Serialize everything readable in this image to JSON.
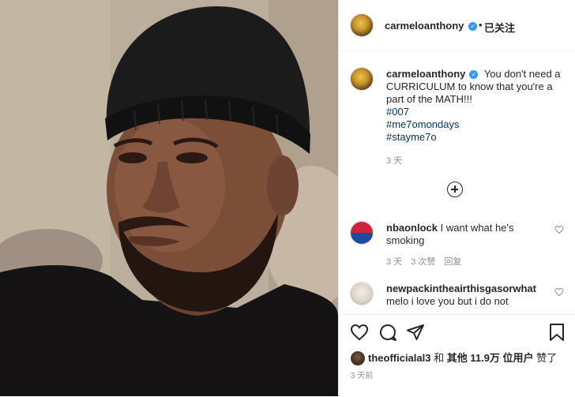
{
  "post": {
    "username": "carmeloanthony",
    "verified_icon": "verified-badge-icon",
    "separator": "•",
    "follow_label": "已关注"
  },
  "caption": {
    "username": "carmeloanthony",
    "text": "You don't need a CURRICULUM to know that you're a part of the MATH!!!",
    "hashtags": [
      "#007",
      "#me7omondays",
      "#stayme7o"
    ],
    "time": "3 天"
  },
  "comments": [
    {
      "username": "nbaonlock",
      "text": "I want what he's smoking",
      "time": "3 天",
      "likes": "3 次赞",
      "reply": "回复"
    },
    {
      "username": "newpackintheairthisgasorwhat",
      "text": "melo i love you but i do not",
      "time": "",
      "likes": "",
      "reply": ""
    }
  ],
  "likes": {
    "first_user": "theofficialal3",
    "connector": "和",
    "others_label": "其他 11.9万 位用户",
    "suffix": "赞了"
  },
  "post_time": "3 天前",
  "icons": {
    "load_more": "plus-circle-icon",
    "like": "heart-icon",
    "comment": "comment-icon",
    "share": "share-icon",
    "save": "bookmark-icon"
  },
  "colors": {
    "link_blue": "#003569",
    "verified_blue": "#3897f0",
    "muted_text": "#8e8e8e"
  }
}
